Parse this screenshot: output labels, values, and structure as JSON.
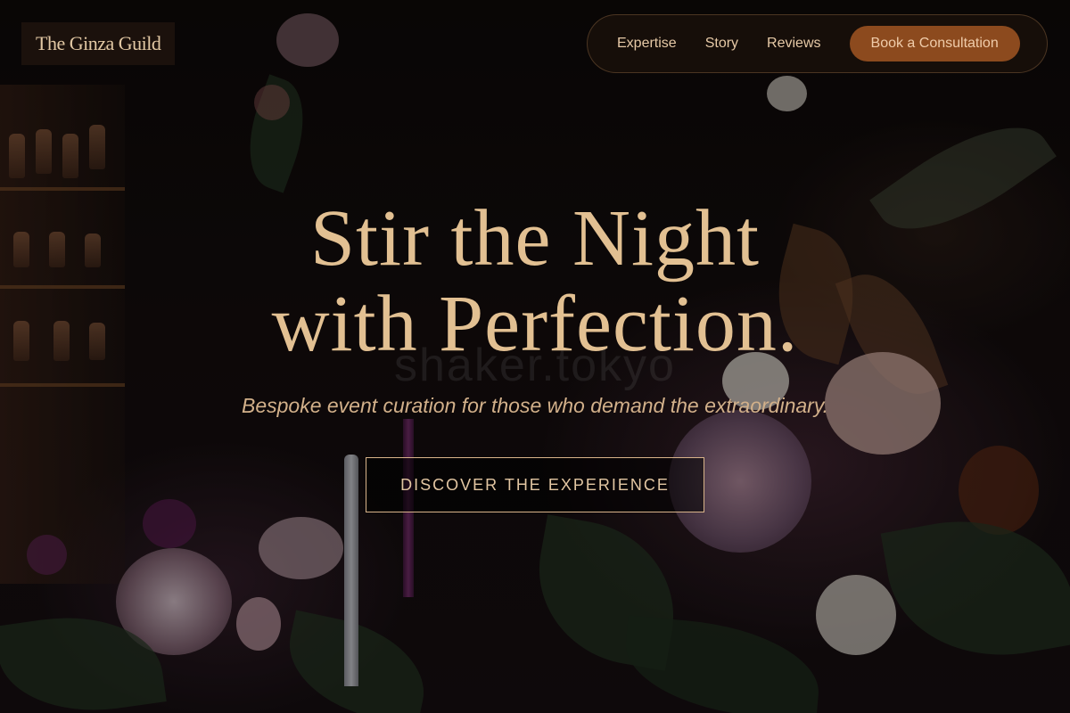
{
  "brand": {
    "name": "The Ginza Guild"
  },
  "nav": {
    "links": [
      "Expertise",
      "Story",
      "Reviews"
    ],
    "cta_label": "Book a Consultation"
  },
  "hero": {
    "headline_line1": "Stir the Night",
    "headline_line2": "with Perfection.",
    "subheadline": "Bespoke event curation for those who demand the extraordinary.",
    "cta_label": "DISCOVER THE EXPERIENCE",
    "background_watermark": "shaker.tokyo"
  },
  "colors": {
    "accent": "#8c4a1e",
    "gold_text": "#e2c092",
    "background": "#0c0908"
  }
}
